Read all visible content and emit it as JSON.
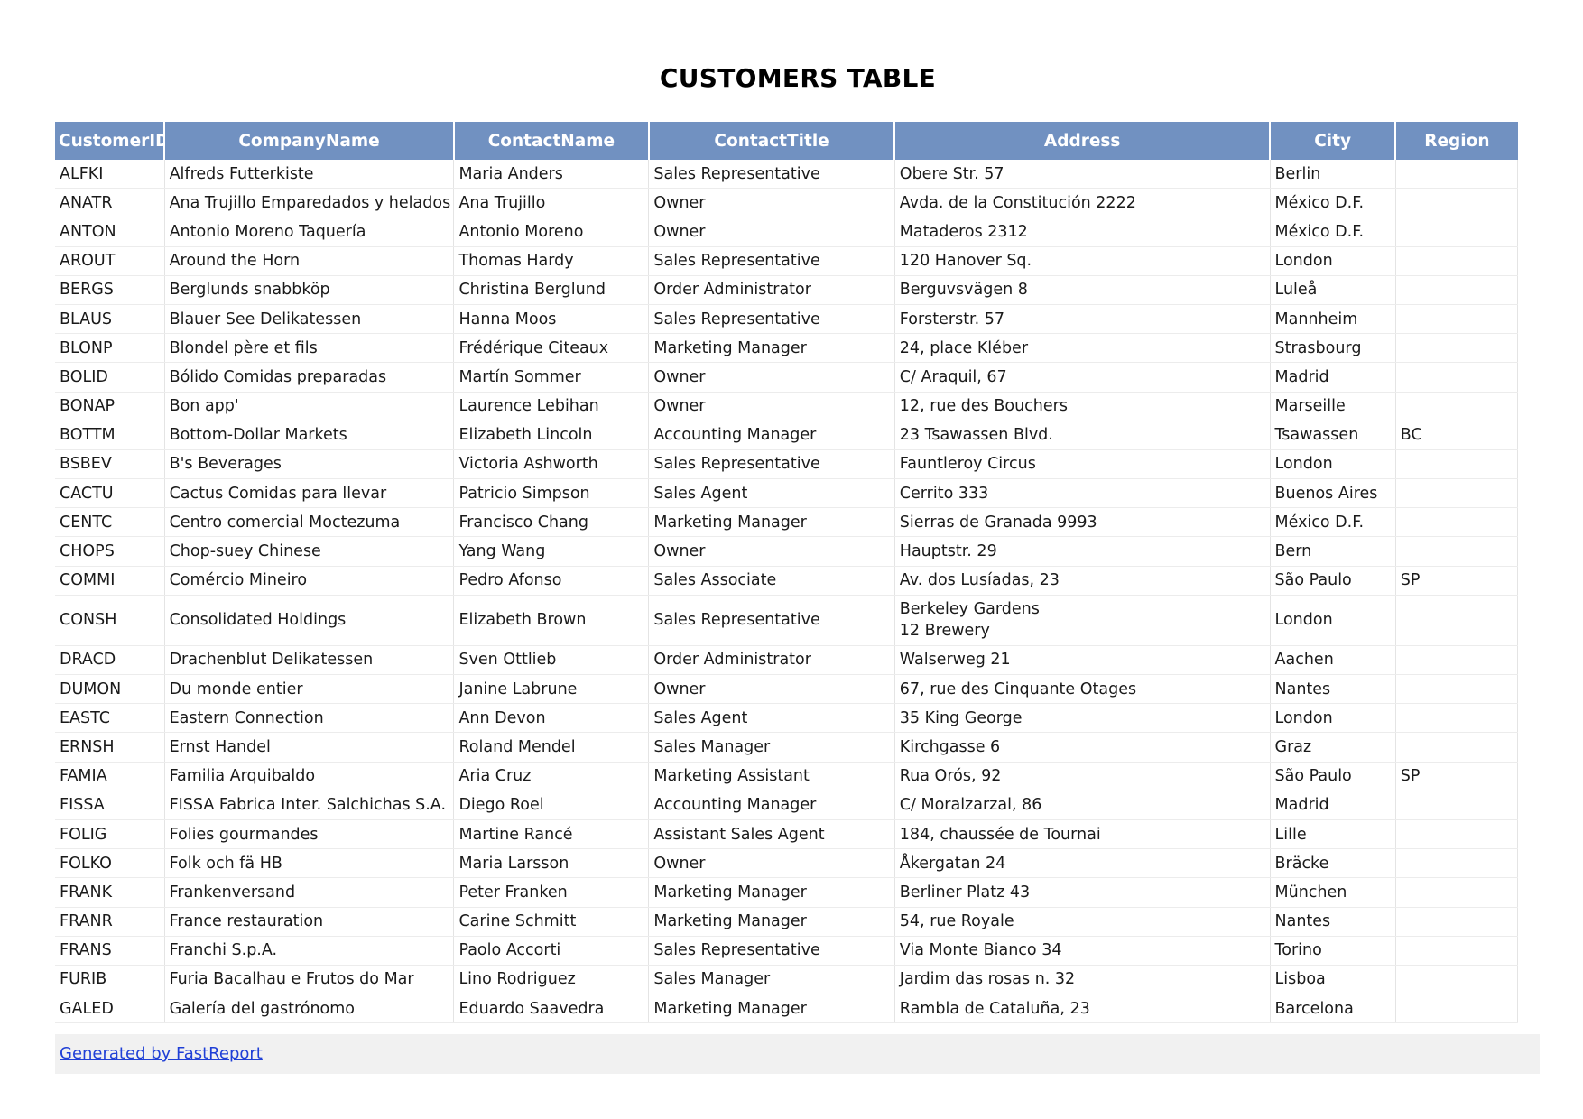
{
  "title": "CUSTOMERS TABLE",
  "columns": [
    "CustomerID",
    "CompanyName",
    "ContactName",
    "ContactTitle",
    "Address",
    "City",
    "Region"
  ],
  "rows": [
    [
      "ALFKI",
      "Alfreds Futterkiste",
      "Maria Anders",
      "Sales Representative",
      "Obere Str. 57",
      "Berlin",
      ""
    ],
    [
      "ANATR",
      "Ana Trujillo Emparedados y helados",
      "Ana Trujillo",
      "Owner",
      "Avda. de la Constitución 2222",
      "México D.F.",
      ""
    ],
    [
      "ANTON",
      "Antonio Moreno Taquería",
      "Antonio Moreno",
      "Owner",
      "Mataderos  2312",
      "México D.F.",
      ""
    ],
    [
      "AROUT",
      "Around the Horn",
      "Thomas Hardy",
      "Sales Representative",
      "120 Hanover Sq.",
      "London",
      ""
    ],
    [
      "BERGS",
      "Berglunds snabbköp",
      "Christina Berglund",
      "Order Administrator",
      "Berguvsvägen  8",
      "Luleå",
      ""
    ],
    [
      "BLAUS",
      "Blauer See Delikatessen",
      "Hanna Moos",
      "Sales Representative",
      "Forsterstr. 57",
      "Mannheim",
      ""
    ],
    [
      "BLONP",
      "Blondel père et fils",
      "Frédérique Citeaux",
      "Marketing Manager",
      "24, place Kléber",
      "Strasbourg",
      ""
    ],
    [
      "BOLID",
      "Bólido Comidas preparadas",
      "Martín Sommer",
      "Owner",
      "C/ Araquil, 67",
      "Madrid",
      ""
    ],
    [
      "BONAP",
      "Bon app'",
      "Laurence Lebihan",
      "Owner",
      "12, rue des Bouchers",
      "Marseille",
      ""
    ],
    [
      "BOTTM",
      "Bottom-Dollar Markets",
      "Elizabeth Lincoln",
      "Accounting Manager",
      "23 Tsawassen Blvd.",
      "Tsawassen",
      "BC"
    ],
    [
      "BSBEV",
      "B's Beverages",
      "Victoria Ashworth",
      "Sales Representative",
      "Fauntleroy Circus",
      "London",
      ""
    ],
    [
      "CACTU",
      "Cactus Comidas para llevar",
      "Patricio Simpson",
      "Sales Agent",
      "Cerrito 333",
      "Buenos Aires",
      ""
    ],
    [
      "CENTC",
      "Centro comercial Moctezuma",
      "Francisco Chang",
      "Marketing Manager",
      "Sierras de Granada 9993",
      "México D.F.",
      ""
    ],
    [
      "CHOPS",
      "Chop-suey Chinese",
      "Yang Wang",
      "Owner",
      "Hauptstr. 29",
      "Bern",
      ""
    ],
    [
      "COMMI",
      "Comércio Mineiro",
      "Pedro Afonso",
      "Sales Associate",
      "Av. dos Lusíadas, 23",
      "São Paulo",
      "SP"
    ],
    [
      "CONSH",
      "Consolidated Holdings",
      "Elizabeth Brown",
      "Sales Representative",
      [
        "Berkeley Gardens",
        "12  Brewery"
      ],
      "London",
      ""
    ],
    [
      "DRACD",
      "Drachenblut Delikatessen",
      "Sven Ottlieb",
      "Order Administrator",
      "Walserweg 21",
      "Aachen",
      ""
    ],
    [
      "DUMON",
      "Du monde entier",
      "Janine Labrune",
      "Owner",
      "67, rue des Cinquante Otages",
      "Nantes",
      ""
    ],
    [
      "EASTC",
      "Eastern Connection",
      "Ann Devon",
      "Sales Agent",
      "35 King George",
      "London",
      ""
    ],
    [
      "ERNSH",
      "Ernst Handel",
      "Roland Mendel",
      "Sales Manager",
      "Kirchgasse 6",
      "Graz",
      ""
    ],
    [
      "FAMIA",
      "Familia Arquibaldo",
      "Aria Cruz",
      "Marketing Assistant",
      "Rua Orós, 92",
      "São Paulo",
      "SP"
    ],
    [
      "FISSA",
      "FISSA Fabrica Inter. Salchichas S.A.",
      "Diego Roel",
      "Accounting Manager",
      "C/ Moralzarzal, 86",
      "Madrid",
      ""
    ],
    [
      "FOLIG",
      "Folies gourmandes",
      "Martine Rancé",
      "Assistant Sales Agent",
      "184, chaussée de Tournai",
      "Lille",
      ""
    ],
    [
      "FOLKO",
      "Folk och fä HB",
      "Maria Larsson",
      "Owner",
      "Åkergatan 24",
      "Bräcke",
      ""
    ],
    [
      "FRANK",
      "Frankenversand",
      "Peter Franken",
      "Marketing Manager",
      "Berliner Platz 43",
      "München",
      ""
    ],
    [
      "FRANR",
      "France restauration",
      "Carine Schmitt",
      "Marketing Manager",
      "54, rue Royale",
      "Nantes",
      ""
    ],
    [
      "FRANS",
      "Franchi S.p.A.",
      "Paolo Accorti",
      "Sales Representative",
      "Via Monte Bianco 34",
      "Torino",
      ""
    ],
    [
      "FURIB",
      "Furia Bacalhau e Frutos do Mar",
      "Lino Rodriguez",
      "Sales Manager",
      "Jardim das rosas n. 32",
      "Lisboa",
      ""
    ],
    [
      "GALED",
      "Galería del gastrónomo",
      "Eduardo Saavedra",
      "Marketing Manager",
      "Rambla de Cataluña, 23",
      "Barcelona",
      ""
    ]
  ],
  "footer": {
    "link_text": "Generated by FastReport"
  },
  "colors": {
    "header_bg": "#7191c1",
    "header_text": "#ffffff",
    "link": "#1f3fd6",
    "footer_bg": "#f1f1f1"
  }
}
